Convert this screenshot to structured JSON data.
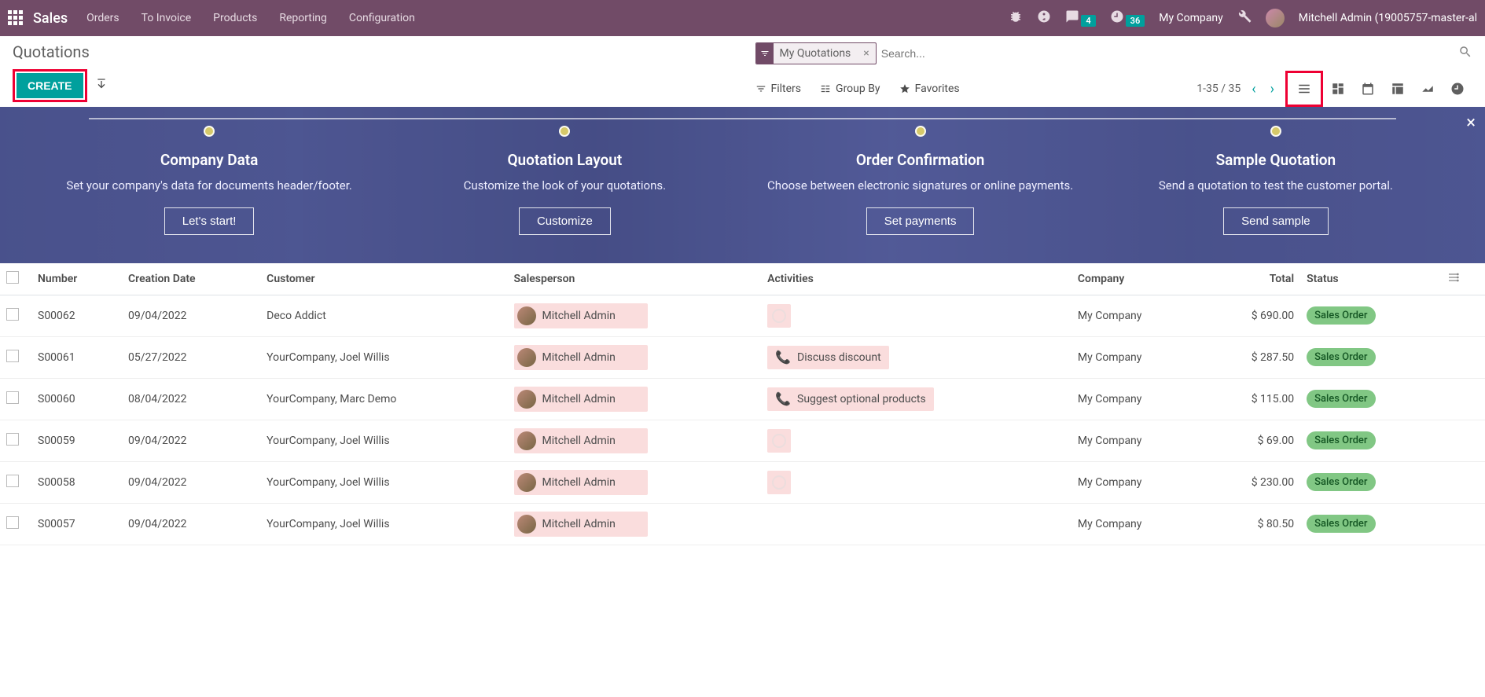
{
  "navbar": {
    "brand": "Sales",
    "menu": [
      "Orders",
      "To Invoice",
      "Products",
      "Reporting",
      "Configuration"
    ],
    "messages_badge": "4",
    "activities_badge": "36",
    "company": "My Company",
    "user": "Mitchell Admin (19005757-master-al"
  },
  "breadcrumb": "Quotations",
  "buttons": {
    "create": "CREATE"
  },
  "search": {
    "facet_label": "My Quotations",
    "placeholder": "Search..."
  },
  "filter_bar": {
    "filters": "Filters",
    "group_by": "Group By",
    "favorites": "Favorites"
  },
  "pager": {
    "text": "1-35 / 35"
  },
  "onboarding": {
    "steps": [
      {
        "title": "Company Data",
        "desc": "Set your company's data for documents header/footer.",
        "btn": "Let's start!"
      },
      {
        "title": "Quotation Layout",
        "desc": "Customize the look of your quotations.",
        "btn": "Customize"
      },
      {
        "title": "Order Confirmation",
        "desc": "Choose between electronic signatures or online payments.",
        "btn": "Set payments"
      },
      {
        "title": "Sample Quotation",
        "desc": "Send a quotation to test the customer portal.",
        "btn": "Send sample"
      }
    ]
  },
  "table": {
    "headers": {
      "number": "Number",
      "creation_date": "Creation Date",
      "customer": "Customer",
      "salesperson": "Salesperson",
      "activities": "Activities",
      "company": "Company",
      "total": "Total",
      "status": "Status"
    },
    "rows": [
      {
        "number": "S00062",
        "date": "09/04/2022",
        "customer": "Deco Addict",
        "sp": "Mitchell Admin",
        "activity": "",
        "activity_type": "clock",
        "company": "My Company",
        "total": "$ 690.00",
        "status": "Sales Order"
      },
      {
        "number": "S00061",
        "date": "05/27/2022",
        "customer": "YourCompany, Joel Willis",
        "sp": "Mitchell Admin",
        "activity": "Discuss discount",
        "activity_type": "phone",
        "company": "My Company",
        "total": "$ 287.50",
        "status": "Sales Order"
      },
      {
        "number": "S00060",
        "date": "08/04/2022",
        "customer": "YourCompany, Marc Demo",
        "sp": "Mitchell Admin",
        "activity": "Suggest optional products",
        "activity_type": "phone",
        "company": "My Company",
        "total": "$ 115.00",
        "status": "Sales Order"
      },
      {
        "number": "S00059",
        "date": "09/04/2022",
        "customer": "YourCompany, Joel Willis",
        "sp": "Mitchell Admin",
        "activity": "",
        "activity_type": "clock",
        "company": "My Company",
        "total": "$ 69.00",
        "status": "Sales Order"
      },
      {
        "number": "S00058",
        "date": "09/04/2022",
        "customer": "YourCompany, Joel Willis",
        "sp": "Mitchell Admin",
        "activity": "",
        "activity_type": "clock",
        "company": "My Company",
        "total": "$ 230.00",
        "status": "Sales Order"
      },
      {
        "number": "S00057",
        "date": "09/04/2022",
        "customer": "YourCompany, Joel Willis",
        "sp": "Mitchell Admin",
        "activity": "",
        "activity_type": "none",
        "company": "My Company",
        "total": "$ 80.50",
        "status": "Sales Order"
      }
    ]
  }
}
